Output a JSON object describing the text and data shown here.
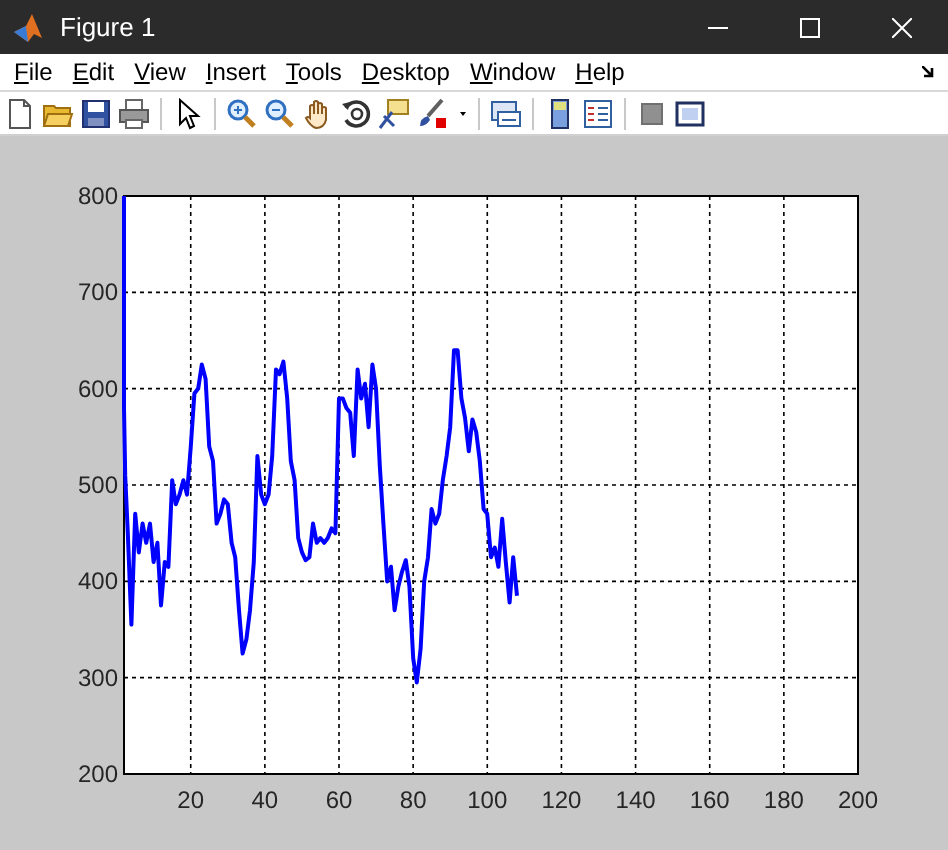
{
  "window": {
    "title": "Figure 1"
  },
  "menu": [
    {
      "label": "File"
    },
    {
      "label": "Edit"
    },
    {
      "label": "View"
    },
    {
      "label": "Insert"
    },
    {
      "label": "Tools"
    },
    {
      "label": "Desktop"
    },
    {
      "label": "Window"
    },
    {
      "label": "Help"
    }
  ],
  "toolbar": [
    {
      "kind": "new"
    },
    {
      "kind": "open"
    },
    {
      "kind": "save"
    },
    {
      "kind": "print"
    },
    {
      "kind": "separator"
    },
    {
      "kind": "pointer"
    },
    {
      "kind": "separator"
    },
    {
      "kind": "zoom-in"
    },
    {
      "kind": "zoom-out"
    },
    {
      "kind": "pan"
    },
    {
      "kind": "rotate"
    },
    {
      "kind": "data-cursor"
    },
    {
      "kind": "brush"
    },
    {
      "kind": "caret"
    },
    {
      "kind": "separator"
    },
    {
      "kind": "link"
    },
    {
      "kind": "separator"
    },
    {
      "kind": "colorbar"
    },
    {
      "kind": "legend"
    },
    {
      "kind": "separator"
    },
    {
      "kind": "hide-tools"
    },
    {
      "kind": "show-tools"
    }
  ],
  "chart_data": {
    "type": "line",
    "grid": true,
    "xlim": [
      2,
      200
    ],
    "ylim": [
      200,
      800
    ],
    "xticks": [
      20,
      40,
      60,
      80,
      100,
      120,
      140,
      160,
      180,
      200
    ],
    "yticks": [
      200,
      300,
      400,
      500,
      600,
      700,
      800
    ],
    "x": [
      2,
      2,
      2,
      2.3,
      3,
      4,
      5,
      6,
      7,
      8,
      9,
      10,
      11,
      12,
      13,
      14,
      15,
      16,
      17,
      18,
      19,
      20,
      21,
      22,
      23,
      24,
      25,
      26,
      27,
      28,
      29,
      30,
      31,
      32,
      33,
      34,
      35,
      36,
      37,
      38,
      39,
      40,
      41,
      42,
      43,
      44,
      45,
      46,
      47,
      48,
      49,
      50,
      51,
      52,
      53,
      54,
      55,
      56,
      57,
      58,
      59,
      60,
      61,
      62,
      63,
      64,
      65,
      66,
      67,
      68,
      69,
      70,
      71,
      72,
      73,
      74,
      75,
      76,
      77,
      78,
      79,
      80,
      81,
      82,
      83,
      84,
      85,
      86,
      87,
      88,
      89,
      90,
      91,
      92,
      93,
      94,
      95,
      96,
      97,
      98,
      99,
      100,
      101,
      102,
      103,
      104,
      105,
      106,
      107,
      108
    ],
    "series": [
      {
        "color": "#0000ff",
        "values": [
          800,
          690,
          580,
          510,
          450,
          355,
          470,
          430,
          460,
          440,
          460,
          420,
          440,
          375,
          420,
          415,
          505,
          480,
          490,
          505,
          490,
          540,
          595,
          600,
          625,
          610,
          540,
          525,
          460,
          470,
          485,
          480,
          440,
          425,
          370,
          325,
          340,
          370,
          420,
          530,
          490,
          480,
          490,
          530,
          620,
          615,
          628,
          590,
          525,
          505,
          445,
          430,
          422,
          425,
          460,
          440,
          445,
          440,
          445,
          455,
          450,
          590,
          590,
          580,
          575,
          530,
          620,
          590,
          605,
          560,
          625,
          600,
          520,
          460,
          400,
          415,
          370,
          395,
          410,
          422,
          395,
          320,
          295,
          330,
          400,
          425,
          475,
          460,
          470,
          505,
          530,
          560,
          640,
          640,
          590,
          570,
          535,
          568,
          555,
          525,
          475,
          470,
          425,
          435,
          415,
          465,
          420,
          378,
          425,
          385
        ]
      }
    ]
  }
}
